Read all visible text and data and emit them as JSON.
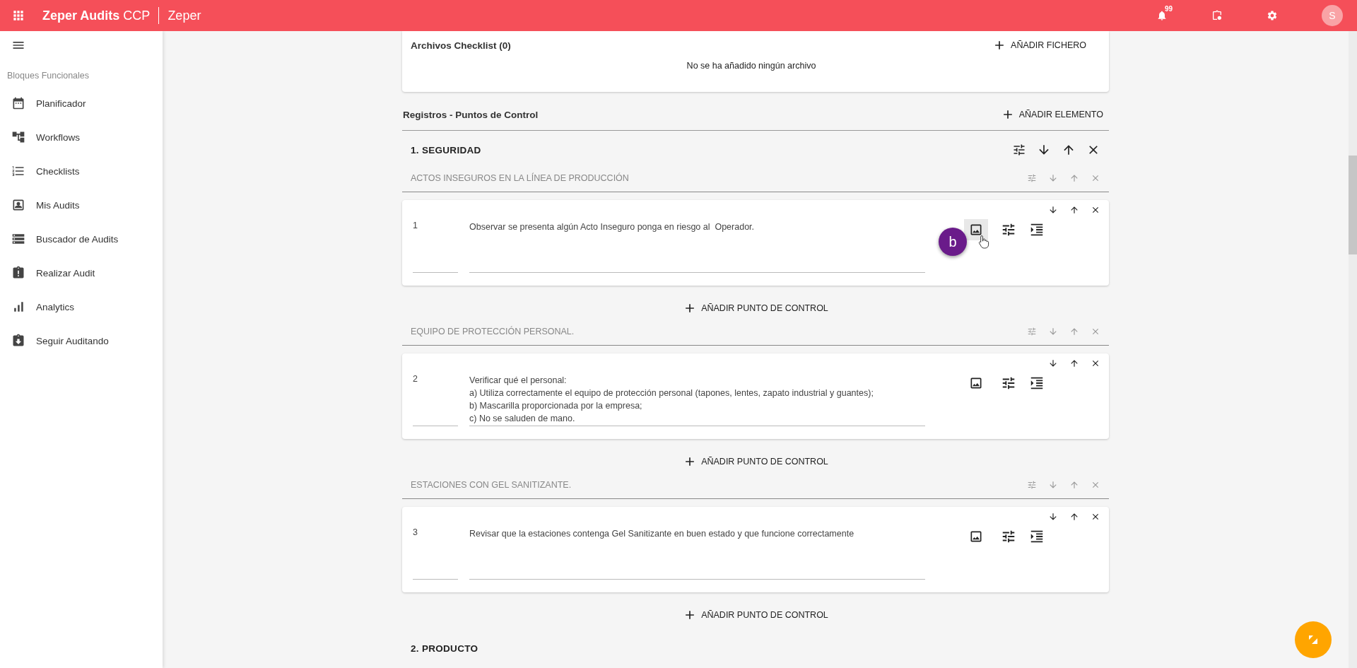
{
  "app_bar": {
    "title": "Zeper Audits",
    "title_suffix": "CCP",
    "company": "Zeper",
    "notification_count": "99",
    "avatar_letter": "S"
  },
  "sidebar": {
    "section": "Bloques Funcionales",
    "items": [
      {
        "label": "Planificador",
        "kind": "calendar"
      },
      {
        "label": "Workflows",
        "kind": "tree"
      },
      {
        "label": "Checklists",
        "kind": "numbered-list"
      },
      {
        "label": "Mis Audits",
        "kind": "contact-card"
      },
      {
        "label": "Buscador de Audits",
        "kind": "rows"
      },
      {
        "label": "Realizar Audit",
        "kind": "clipboard-alert"
      },
      {
        "label": "Analytics",
        "kind": "bar-chart"
      },
      {
        "label": "Seguir Auditando",
        "kind": "clipboard-download"
      }
    ]
  },
  "files_card": {
    "title": "Archivos Checklist (0)",
    "add_button": "AÑADIR FICHERO",
    "empty_message": "No se ha añadido ningún archivo"
  },
  "records": {
    "title": "Registros - Puntos de Control",
    "add_button": "AÑADIR ELEMENTO",
    "sections": [
      {
        "title": "1. SEGURIDAD",
        "groups": [
          {
            "title": "ACTOS INSEGUROS EN LA LÍNEA DE PRODUCCIÓN",
            "add_button": "AÑADIR PUNTO DE CONTROL",
            "points": [
              {
                "number": "1",
                "lines": [
                  "Observar se presenta algún Acto Inseguro ponga en riesgo al  Operador."
                ],
                "image_hovered": true,
                "marker": "b"
              }
            ]
          },
          {
            "title": "EQUIPO DE PROTECCIÓN PERSONAL.",
            "add_button": "AÑADIR PUNTO DE CONTROL",
            "points": [
              {
                "number": "2",
                "lines": [
                  "Verificar qué el personal:",
                  "a) Utiliza correctamente el equipo de protección personal (tapones, lentes, zapato industrial y guantes);",
                  "b) Mascarilla proporcionada por la empresa;",
                  "c) No se saluden de mano."
                ],
                "image_hovered": false
              }
            ]
          },
          {
            "title": "ESTACIONES CON GEL SANITIZANTE.",
            "add_button": "AÑADIR PUNTO DE CONTROL",
            "points": [
              {
                "number": "3",
                "lines": [
                  "Revisar que la estaciones contenga Gel Sanitizante en buen estado y que funcione correctamente"
                ],
                "image_hovered": false
              }
            ]
          }
        ]
      },
      {
        "title": "2. PRODUCTO"
      }
    ]
  }
}
